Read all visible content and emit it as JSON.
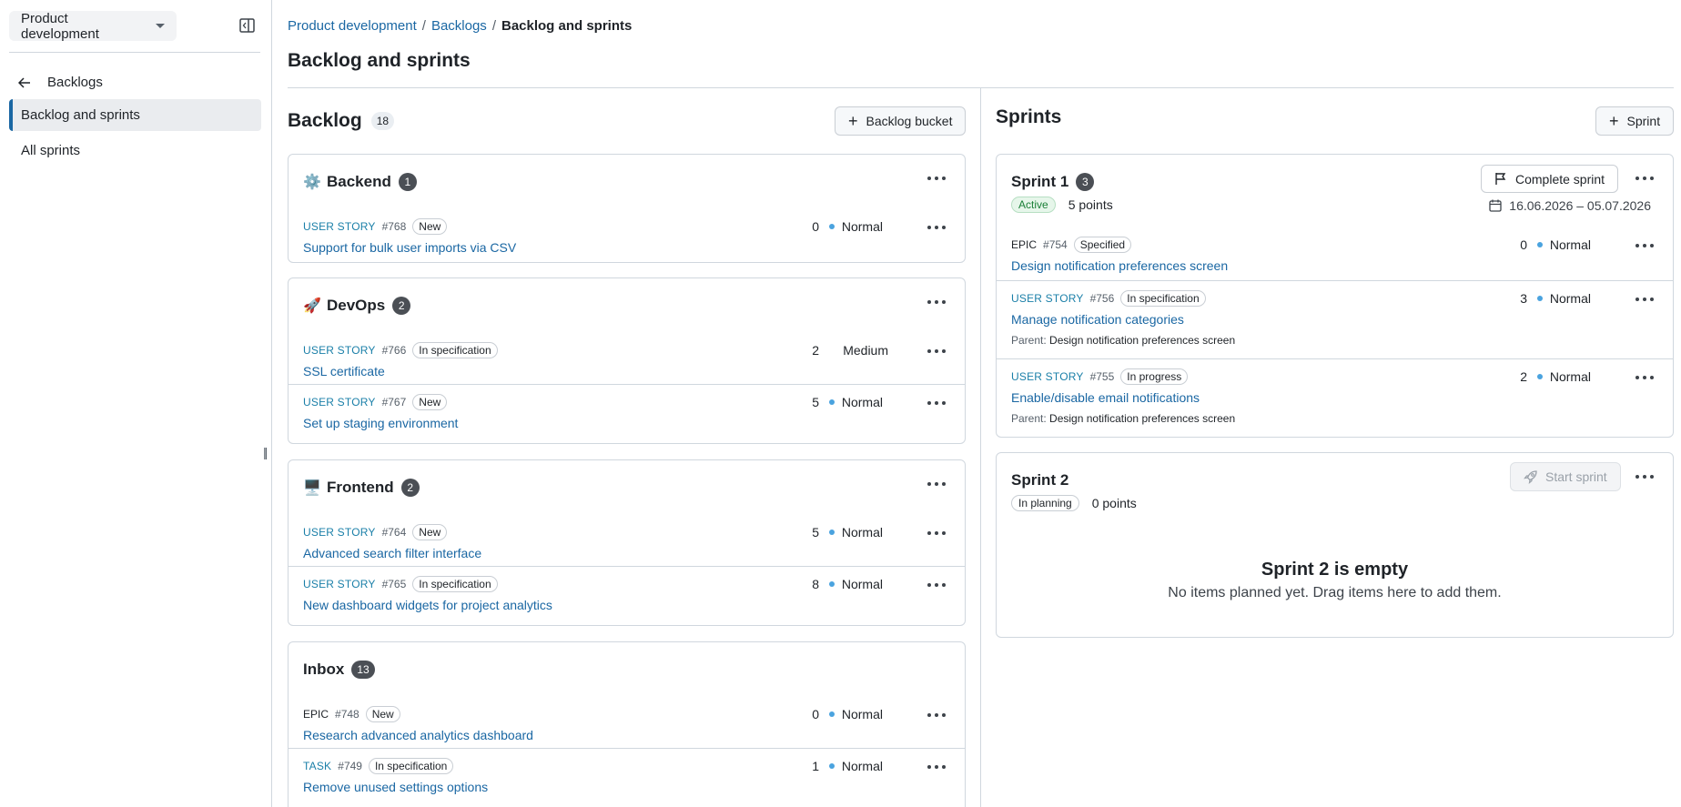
{
  "sidebar": {
    "project": "Product development",
    "back_label": "Backlogs",
    "items": [
      {
        "label": "Backlog and sprints"
      },
      {
        "label": "All sprints"
      }
    ]
  },
  "breadcrumb": {
    "items": [
      "Product development",
      "Backlogs",
      "Backlog and sprints"
    ],
    "separator": "/"
  },
  "page_title": "Backlog and sprints",
  "backlog": {
    "title": "Backlog",
    "count": "18",
    "add_bucket_label": "Backlog bucket",
    "buckets": [
      {
        "name": "Backend",
        "emoji": "⚙️",
        "count": "1",
        "items": [
          {
            "type": "USER STORY",
            "id": "#768",
            "status": "New",
            "title": "Support for bulk user imports via CSV",
            "points": "0",
            "priority": "Normal"
          }
        ]
      },
      {
        "name": "DevOps",
        "emoji": "🚀",
        "count": "2",
        "items": [
          {
            "type": "USER STORY",
            "id": "#766",
            "status": "In specification",
            "title": "SSL certificate",
            "points": "2",
            "priority": "Medium"
          },
          {
            "type": "USER STORY",
            "id": "#767",
            "status": "New",
            "title": "Set up staging environment",
            "points": "5",
            "priority": "Normal"
          }
        ]
      },
      {
        "name": "Frontend",
        "emoji": "🖥️",
        "count": "2",
        "items": [
          {
            "type": "USER STORY",
            "id": "#764",
            "status": "New",
            "title": "Advanced search filter interface",
            "points": "5",
            "priority": "Normal"
          },
          {
            "type": "USER STORY",
            "id": "#765",
            "status": "In specification",
            "title": "New dashboard widgets for project analytics",
            "points": "8",
            "priority": "Normal"
          }
        ]
      },
      {
        "name": "Inbox",
        "emoji": "",
        "count": "13",
        "items": [
          {
            "type": "EPIC",
            "id": "#748",
            "status": "New",
            "title": "Research advanced analytics dashboard",
            "points": "0",
            "priority": "Normal"
          },
          {
            "type": "TASK",
            "id": "#749",
            "status": "In specification",
            "title": "Remove unused settings options",
            "points": "1",
            "priority": "Normal"
          }
        ]
      }
    ]
  },
  "sprints": {
    "title": "Sprints",
    "add_sprint_label": "Sprint",
    "sprint1": {
      "name": "Sprint 1",
      "count": "3",
      "state": "Active",
      "points": "5 points",
      "dates": "16.06.2026 – 05.07.2026",
      "action_label": "Complete sprint",
      "items": [
        {
          "type": "EPIC",
          "id": "#754",
          "status": "Specified",
          "title": "Design notification preferences screen",
          "points": "0",
          "priority": "Normal"
        },
        {
          "type": "USER STORY",
          "id": "#756",
          "status": "In specification",
          "title": "Manage notification categories",
          "points": "3",
          "priority": "Normal",
          "parent_label": "Parent:",
          "parent": "Design notification preferences screen"
        },
        {
          "type": "USER STORY",
          "id": "#755",
          "status": "In progress",
          "title": "Enable/disable email notifications",
          "points": "2",
          "priority": "Normal",
          "parent_label": "Parent:",
          "parent": "Design notification preferences screen"
        }
      ]
    },
    "sprint2": {
      "name": "Sprint 2",
      "state": "In planning",
      "points": "0 points",
      "action_label": "Start sprint",
      "empty_title": "Sprint 2 is empty",
      "empty_text": "No items planned yet. Drag items here to add them."
    }
  },
  "colors": {
    "link": "#1a67a3",
    "story_type": "#1a7fa8",
    "priority_dot": "#4aa3df",
    "active_green": "#1a7f37"
  }
}
